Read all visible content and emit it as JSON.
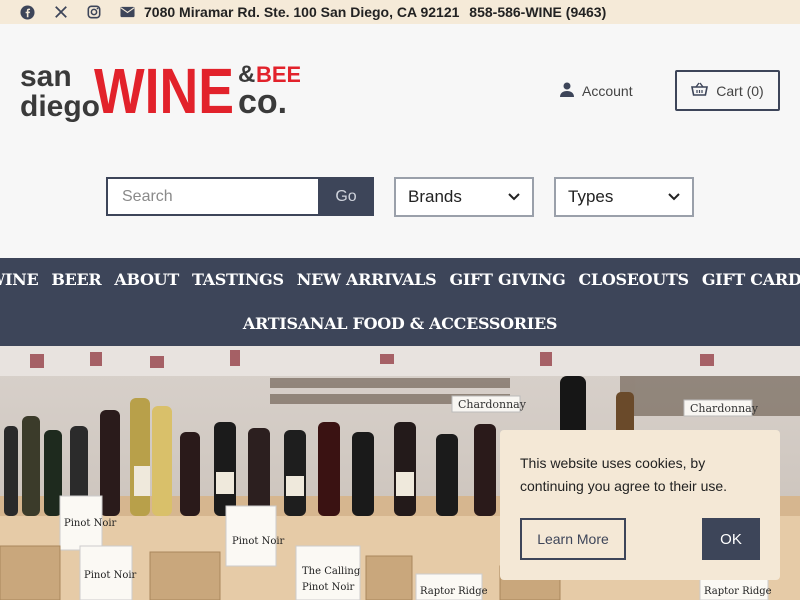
{
  "topbar": {
    "address": "7080 Miramar Rd. Ste. 100 San Diego, CA 92121",
    "phone": "858-586-WINE (9463)",
    "icons": [
      "facebook-icon",
      "x-icon",
      "instagram-icon",
      "envelope-icon"
    ]
  },
  "logo": {
    "line1": "san",
    "line2": "diego",
    "wine": "WINE",
    "amp": "&",
    "beer": "BEER",
    "co": "co."
  },
  "header": {
    "account_label": "Account",
    "cart_label": "Cart (0)"
  },
  "search": {
    "placeholder": "Search",
    "go_label": "Go"
  },
  "filters": {
    "brands_selected": "Brands",
    "types_selected": "Types"
  },
  "nav": {
    "items": [
      "WINE",
      "BEER",
      "ABOUT",
      "TASTINGS",
      "NEW ARRIVALS",
      "GIFT GIVING",
      "CLOSEOUTS",
      "GIFT CARDS",
      "ARTISANAL FOOD & ACCESSORIES"
    ]
  },
  "hero": {
    "signs": [
      "Chardonnay",
      "Chardonnay",
      "Pinot Noir",
      "Pinot Noir",
      "The Calling",
      "Pinot Noir",
      "Raptor Ridge",
      "Pinot Noir",
      "Raptor Ridge"
    ]
  },
  "cookie": {
    "message": "This website uses cookies, by continuing you agree to their use.",
    "learn_more": "Learn More",
    "ok": "OK"
  },
  "colors": {
    "topbar_bg": "#f5ead8",
    "nav_bg": "#3d4559",
    "logo_red": "#e2222b",
    "logo_gray": "#3a3a3a"
  }
}
